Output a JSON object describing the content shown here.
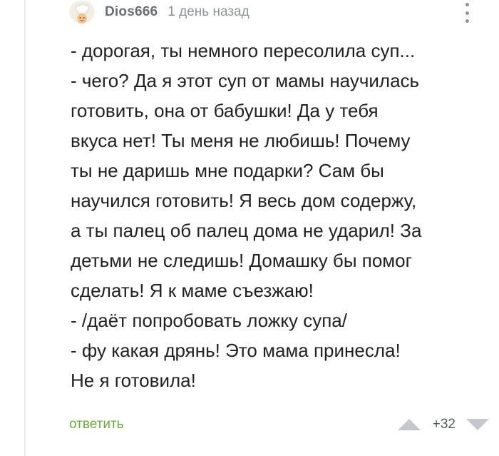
{
  "comment": {
    "author": "Dios666",
    "timestamp": "1 день назад",
    "avatar_icon": "chef-avatar-icon",
    "more_icon": "vertical-dots-icon",
    "lines": [
      "- дорогая, ты немного пересолила суп...",
      "- чего? Да я этот суп от мамы научилась",
      "готовить, она от бабушки! Да у тебя",
      "вкуса нет! Ты меня не любишь! Почему",
      "ты не даришь мне подарки? Сам бы",
      "научился готовить! Я весь дом содержу,",
      "а ты палец об палец дома не ударил! За",
      "детьми не следишь! Домашку бы помог",
      "сделать! Я к маме съезжаю!",
      "- /даёт попробовать ложку супа/",
      "- фу какая дрянь! Это мама принесла!",
      "Не я готовила!"
    ],
    "reply_label": "ответить",
    "rating": "+32",
    "upvote_icon": "upvote-arrow-icon",
    "downvote_icon": "downvote-arrow-icon"
  },
  "colors": {
    "reply": "#6aaa3d",
    "meta": "#8f949a",
    "text": "#222222",
    "vote_arrow": "#c4c8cc"
  }
}
